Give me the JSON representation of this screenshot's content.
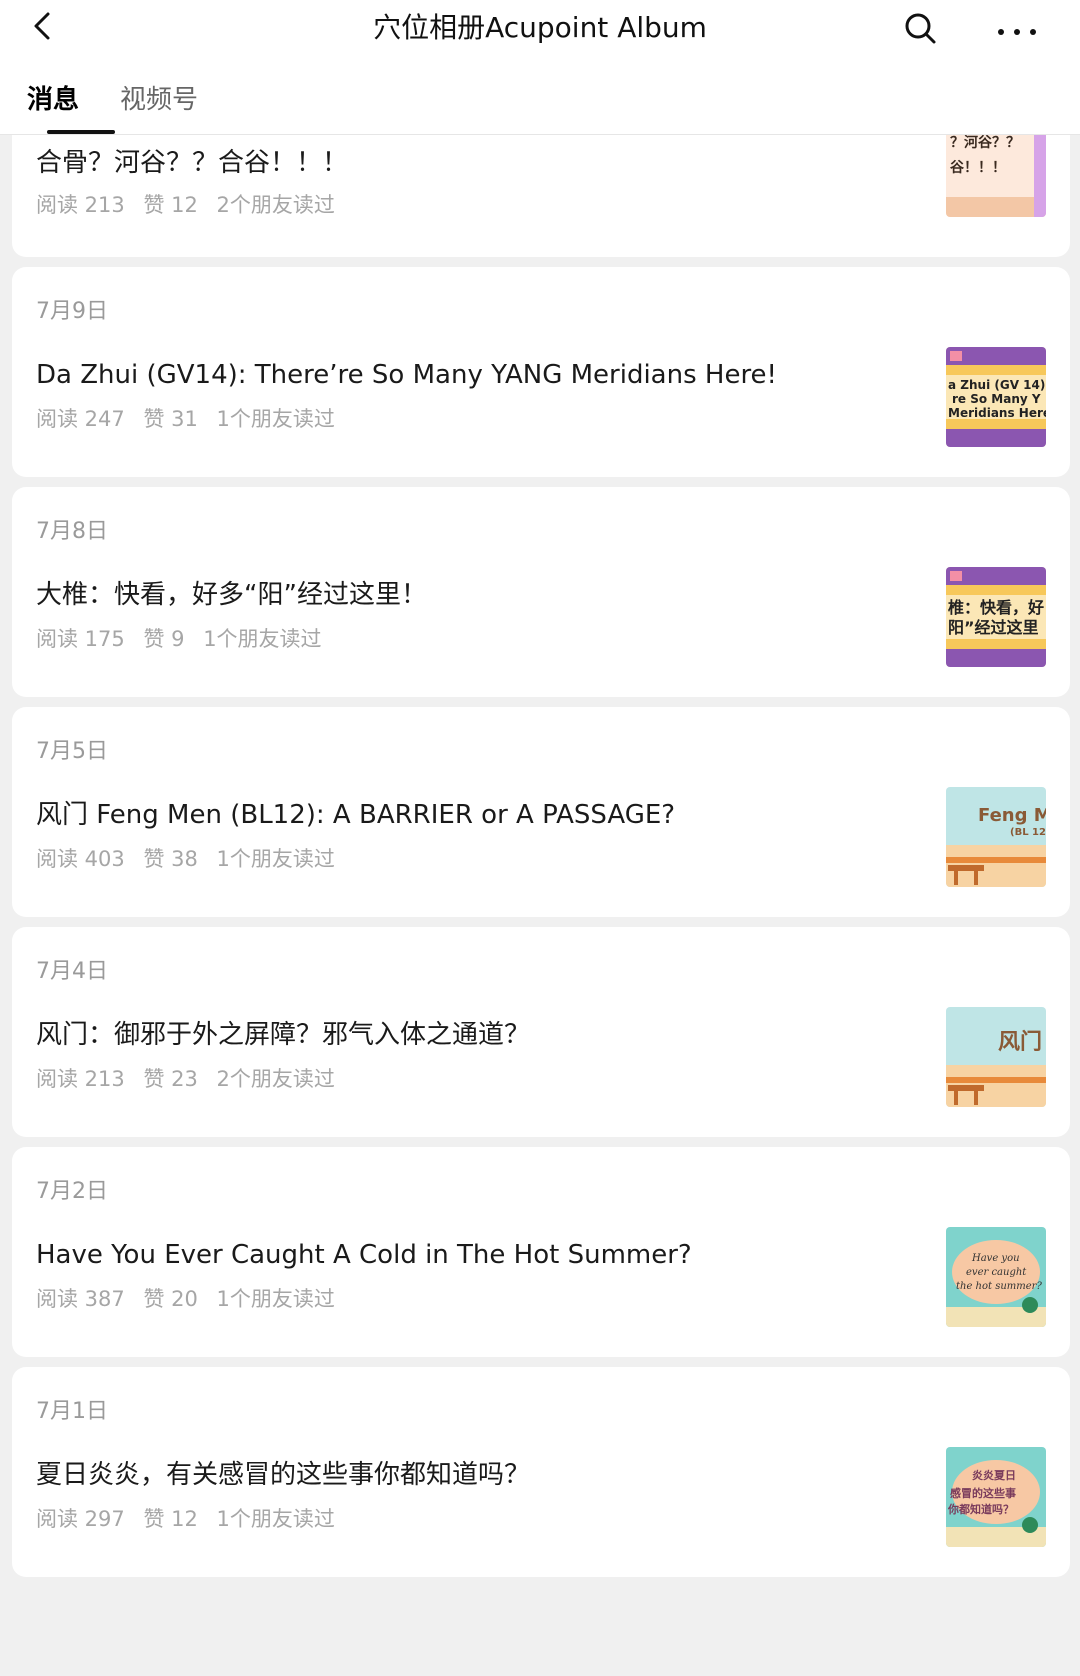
{
  "header": {
    "title": "穴位相册Acupoint Album",
    "tabs": [
      {
        "label": "消息"
      },
      {
        "label": "视频号"
      }
    ]
  },
  "articles": [
    {
      "date": "",
      "title": "合骨？河谷？？合谷！！！",
      "reads": "阅读 213",
      "likes": "赞 12",
      "friends": "2个朋友读过",
      "thumb_text": "？河谷？？ 谷！！！"
    },
    {
      "date": "7月9日",
      "title": "Da Zhui (GV14): There’re So Many YANG Meridians Here!",
      "reads": "阅读 247",
      "likes": "赞 31",
      "friends": "1个朋友读过",
      "thumb_text": "a Zhui (GV 14): re So Many Y Meridians Here!"
    },
    {
      "date": "7月8日",
      "title": "大椎：快看，好多“阳”经过这里！",
      "reads": "阅读 175",
      "likes": "赞 9",
      "friends": "1个朋友读过",
      "thumb_text": "椎：快看，好 阳”经过这里"
    },
    {
      "date": "7月5日",
      "title": "风门 Feng Men (BL12): A BARRIER or A PASSAGE?",
      "reads": "阅读 403",
      "likes": "赞 38",
      "friends": "1个朋友读过",
      "thumb_text": "Feng M (BL 12)"
    },
    {
      "date": "7月4日",
      "title": "风门：御邪于外之屏障？邪气入体之通道？",
      "reads": "阅读 213",
      "likes": "赞 23",
      "friends": "2个朋友读过",
      "thumb_text": "风门"
    },
    {
      "date": "7月2日",
      "title": "Have You Ever Caught A Cold in The Hot Summer?",
      "reads": "阅读 387",
      "likes": "赞 20",
      "friends": "1个朋友读过",
      "thumb_text": "Have you ever caught the hot summer?"
    },
    {
      "date": "7月1日",
      "title": "夏日炎炎，有关感冒的这些事你都知道吗？",
      "reads": "阅读 297",
      "likes": "赞 12",
      "friends": "1个朋友读过",
      "thumb_text": "炎炎夏日 感冒的这些事 你都知道吗？"
    }
  ],
  "icons": {
    "back": "chevron-left-icon",
    "search": "search-icon",
    "more": "more-horizontal-icon"
  },
  "colors": {
    "background": "#f0f0f0",
    "card": "#ffffff",
    "meta": "#a6a6a6",
    "date": "#9a9a9a",
    "thumb_yellow": "#f7c85a",
    "thumb_purple": "#8b56b0",
    "thumb_teal": "#7fd3cc",
    "thumb_peach": "#f7c8a4"
  }
}
